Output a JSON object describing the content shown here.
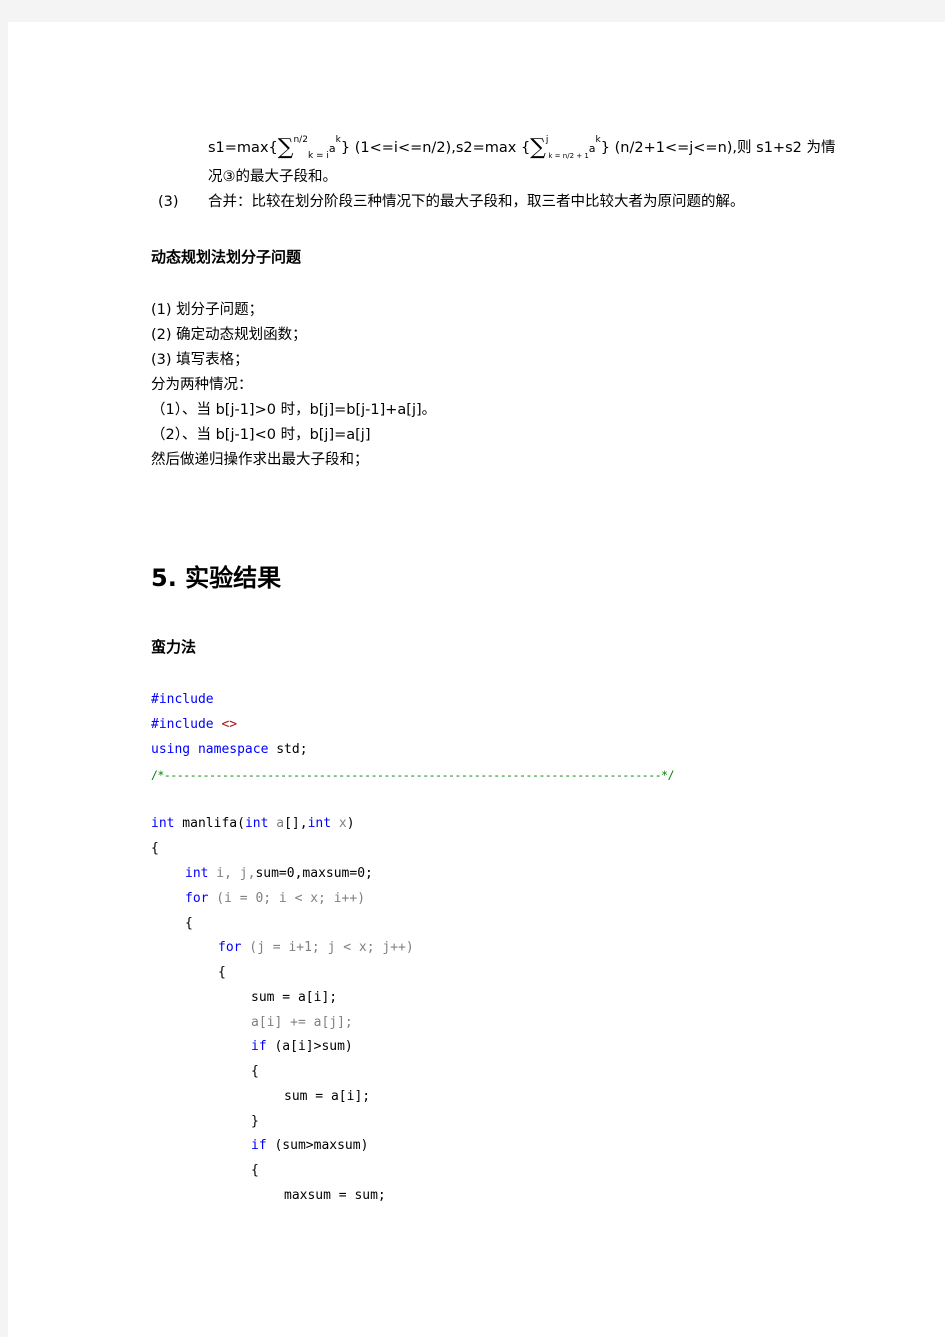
{
  "formula_line": {
    "s1_prefix": "s1=max{",
    "sum1_top": "n/2",
    "sum1_bottom": "k = i",
    "term": "a",
    "term_sup": "k",
    "close1": "}",
    "range1": "(1<=i<=n/2),",
    "s2_prefix": "s2=max {",
    "sum2_top": "j",
    "sum2_bottom": "k = n/2 + 1",
    "close2": "}",
    "range2": "(n/2+1<=j<=n),",
    "tail": "则 s1+s2 为情"
  },
  "formula_continuation": "况③的最大子段和。",
  "step3": {
    "number": "(3)",
    "text": "合并：比较在划分阶段三种情况下的最大子段和，取三者中比较大者为原问题的解。"
  },
  "dp_section": {
    "heading": "动态规划法划分子问题",
    "lines": [
      "(1) 划分子问题；",
      "(2) 确定动态规划函数；",
      "(3) 填写表格；",
      "分为两种情况：",
      "（1）、当 b[j-1]>0 时，b[j]=b[j-1]+a[j]。",
      "（2）、当 b[j-1]<0 时，b[j]=a[j]",
      "然后做递归操作求出最大子段和；"
    ]
  },
  "results_section": {
    "heading": "5. 实验结果",
    "subheading": "蛮力法"
  },
  "code": {
    "include1": "#include",
    "include2_kw": "#include",
    "include2_arg": "<>",
    "using_kw": "using namespace",
    "using_rest": " std;",
    "comment_line": "/*-----------------------------------------------------------------------------*/",
    "func_sig": {
      "ret": "int",
      "name": " manlifa(",
      "p1_type": "int",
      "p1_name": " a",
      "p1_rest": "[],",
      "p2_type": "int",
      "p2_name": " x",
      "close": ")"
    },
    "open_brace": "{",
    "decl": {
      "kw": "int",
      "vars": " i,  j,",
      "rest": "sum=0,maxsum=0;"
    },
    "for1": {
      "kw": "for",
      "rest": " (i = 0; i < x; i++)"
    },
    "for2": {
      "kw": "for",
      "rest": " (j = i+1; j < x; j++)"
    },
    "stmt_sum_assign": "sum = a[i];",
    "stmt_add": "a[i] += a[j];",
    "if1": {
      "kw": "if",
      "rest": " (a[i]>sum)"
    },
    "stmt_sum_assign2": "sum = a[i];",
    "close_brace": "}",
    "if2": {
      "kw": "if",
      "rest": " (sum>maxsum)"
    },
    "stmt_maxsum": "maxsum = sum;"
  }
}
